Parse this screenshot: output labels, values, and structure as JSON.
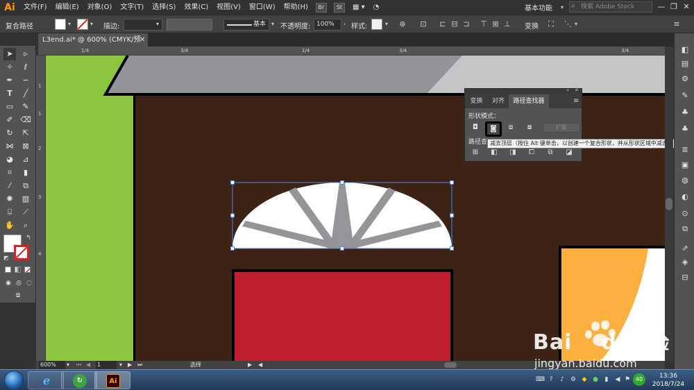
{
  "app": {
    "logo": "Ai",
    "menu": [
      "文件(F)",
      "编辑(E)",
      "对象(O)",
      "文字(T)",
      "选择(S)",
      "效果(C)",
      "视图(V)",
      "窗口(W)",
      "帮助(H)"
    ],
    "bridge_badge": "Br",
    "stock_badge": "St",
    "workspace": "基本功能",
    "search_placeholder": "搜索 Adobe Stock"
  },
  "control": {
    "selection_type": "复合路径",
    "stroke_label": "描边:",
    "brush_label": "基本",
    "opacity_label": "不透明度:",
    "opacity_value": "100%",
    "style_label": "样式:",
    "transform_label": "变换"
  },
  "document": {
    "tab_title": "L3end.ai* @ 600% (CMYK/预览)"
  },
  "rulers": {
    "top_ticks": [
      "1/4",
      "1/4",
      "3/4",
      "3/4",
      "3/4"
    ],
    "left_ticks": [
      "1",
      "1",
      "2",
      "3",
      "4"
    ]
  },
  "status": {
    "zoom": "600%",
    "artboard": "1",
    "tool": "选择"
  },
  "pathfinder": {
    "tabs": [
      "变换",
      "对齐",
      "路径查找器"
    ],
    "active_tab": "路径查找器",
    "shape_modes_label": "形状模式：",
    "pathfinders_label": "路径查",
    "expand_label": "扩展",
    "tooltip": "减去顶层（按住 Alt 键单击，以创建一个复合形状，并从形状区域中减去）"
  },
  "taskbar": {
    "time": "13:36",
    "date": "2018/7/24",
    "ai_label": "Ai",
    "tray_badge": "40"
  },
  "watermark": {
    "brand_prefix": "Bai",
    "brand_suffix": "du",
    "brand_cn": "经验",
    "url": "jingyan.baidu.com"
  },
  "colors": {
    "canvas_brown": "#3c2315",
    "green": "#8cc63f",
    "roof_gray": "#929497",
    "roof_light": "#c4c5c7",
    "door_red": "#be1e2d",
    "window_orange": "#fbb040",
    "selection_blue": "#4b8bf4",
    "ai_orange": "#ff9a00"
  }
}
